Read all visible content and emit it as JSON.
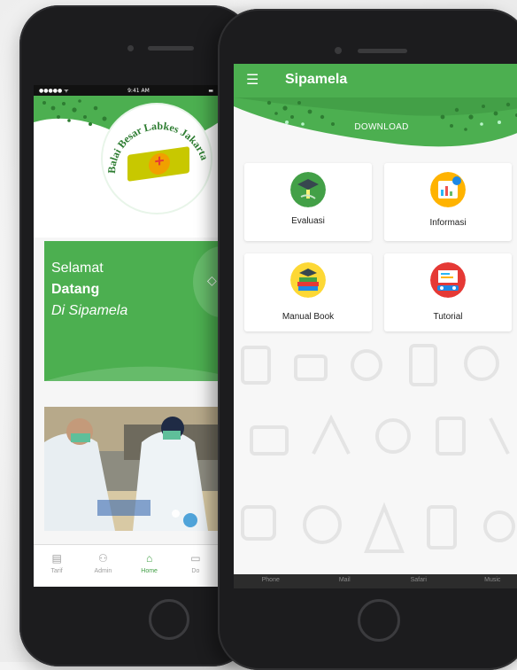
{
  "phone_left": {
    "status": {
      "carrier": "●●●●● ᯤ",
      "time": "9:41 AM"
    },
    "logo_text": "Balai Besar Labkes Jakarta",
    "welcome": {
      "line1": "Selamat",
      "line2": "Datang",
      "line3": "Di Sipamela"
    },
    "tabs": [
      {
        "label": "Tarif",
        "icon": "clipboard-icon"
      },
      {
        "label": "Admin",
        "icon": "people-icon"
      },
      {
        "label": "Home",
        "icon": "home-icon",
        "active": true
      },
      {
        "label": "Do",
        "icon": "doc-icon"
      }
    ]
  },
  "phone_right": {
    "app_title": "Sipamela",
    "download_label": "DOWNLOAD",
    "menu": [
      {
        "label": "Evaluasi",
        "icon": "graduation-icon",
        "color": "#43a047"
      },
      {
        "label": "Informasi",
        "icon": "chart-board-icon",
        "color": "#ffb300"
      },
      {
        "label": "Manual Book",
        "icon": "books-icon",
        "color": "#fdd835"
      },
      {
        "label": "Tutorial",
        "icon": "projector-icon",
        "color": "#e53935"
      }
    ],
    "bottom_tabs": [
      "Phone",
      "Mail",
      "Safari",
      "Music"
    ]
  },
  "colors": {
    "primary_green": "#4caf50",
    "dark_green": "#2e7d32"
  }
}
